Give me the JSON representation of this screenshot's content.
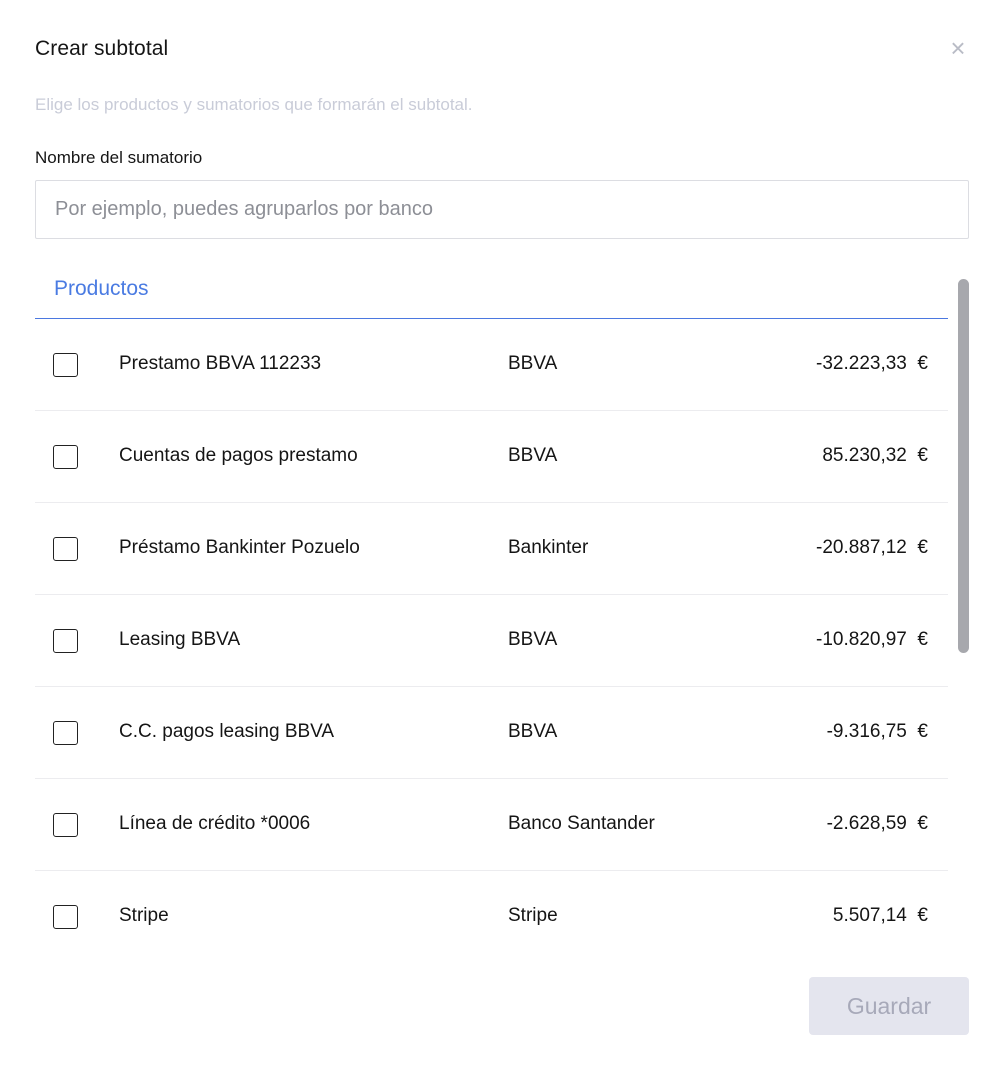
{
  "dialog": {
    "title": "Crear subtotal",
    "close_glyph": "×",
    "subtitle": "Elige los productos y sumatorios que formarán el subtotal.",
    "name_label": "Nombre del sumatorio",
    "name_value": "",
    "name_placeholder": "Por ejemplo, puedes agruparlos por banco",
    "tab_label": "Productos",
    "save_label": "Guardar"
  },
  "products": [
    {
      "name": "Prestamo BBVA 112233",
      "bank": "BBVA",
      "amount": "-32.223,33  €",
      "checked": false
    },
    {
      "name": "Cuentas de pagos prestamo",
      "bank": "BBVA",
      "amount": "85.230,32  €",
      "checked": false
    },
    {
      "name": "Préstamo Bankinter Pozuelo",
      "bank": "Bankinter",
      "amount": "-20.887,12  €",
      "checked": false
    },
    {
      "name": "Leasing BBVA",
      "bank": "BBVA",
      "amount": "-10.820,97  €",
      "checked": false
    },
    {
      "name": "C.C. pagos leasing BBVA",
      "bank": "BBVA",
      "amount": "-9.316,75  €",
      "checked": false
    },
    {
      "name": "Línea de crédito *0006",
      "bank": "Banco Santander",
      "amount": "-2.628,59  €",
      "checked": false
    },
    {
      "name": "Stripe",
      "bank": "Stripe",
      "amount": "5.507,14  €",
      "checked": false
    }
  ],
  "colors": {
    "accent": "#4a7be2",
    "save_bg_disabled": "#e4e5ee",
    "save_text_disabled": "#a7a9b9",
    "subtitle": "#c9ccd8"
  }
}
